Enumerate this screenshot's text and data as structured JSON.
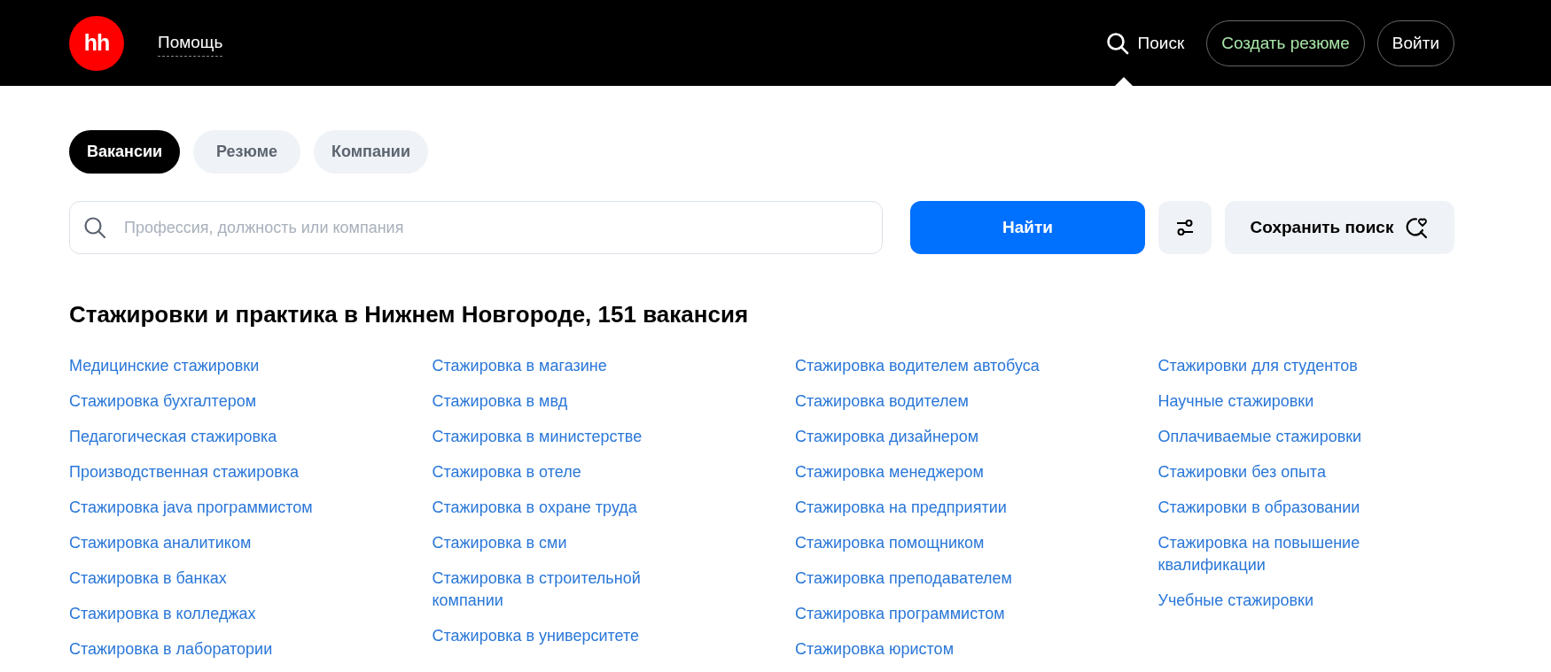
{
  "header": {
    "logo": "hh",
    "help_link": "Помощь",
    "search": {
      "label": "Поиск",
      "selected": true
    },
    "create_resume": "Создать резюме",
    "login": "Войти"
  },
  "tabs": [
    {
      "label": "Вакансии",
      "selected": true
    },
    {
      "label": "Резюме",
      "selected": false
    },
    {
      "label": "Компании",
      "selected": false
    }
  ],
  "search": {
    "placeholder": "Профессия, должность или компания",
    "submit": "Найти",
    "save": "Сохранить поиск"
  },
  "heading": "Стажировки и практика в Нижнем Новгороде, 151 вакансия",
  "link_columns": [
    [
      "Медицинские стажировки",
      "Стажировка бухгалтером",
      "Педагогическая стажировка",
      "Производственная стажировка",
      "Стажировка java программистом",
      "Стажировка аналитиком",
      "Стажировка в банках",
      "Стажировка в колледжах",
      "Стажировка в лаборатории"
    ],
    [
      "Стажировка в магазине",
      "Стажировка в мвд",
      "Стажировка в министерстве",
      "Стажировка в отеле",
      "Стажировка в охране труда",
      "Стажировка в сми",
      "Стажировка в строительной компании",
      "Стажировка в университете"
    ],
    [
      "Стажировка водителем автобуса",
      "Стажировка водителем",
      "Стажировка дизайнером",
      "Стажировка менеджером",
      "Стажировка на предприятии",
      "Стажировка помощником",
      "Стажировка преподавателем",
      "Стажировка программистом",
      "Стажировка юристом"
    ],
    [
      "Стажировки для студентов",
      "Научные стажировки",
      "Оплачиваемые стажировки",
      "Стажировки без опыта",
      "Стажировки в образовании",
      "Стажировка на повышение квалификации",
      "Учебные стажировки"
    ]
  ]
}
